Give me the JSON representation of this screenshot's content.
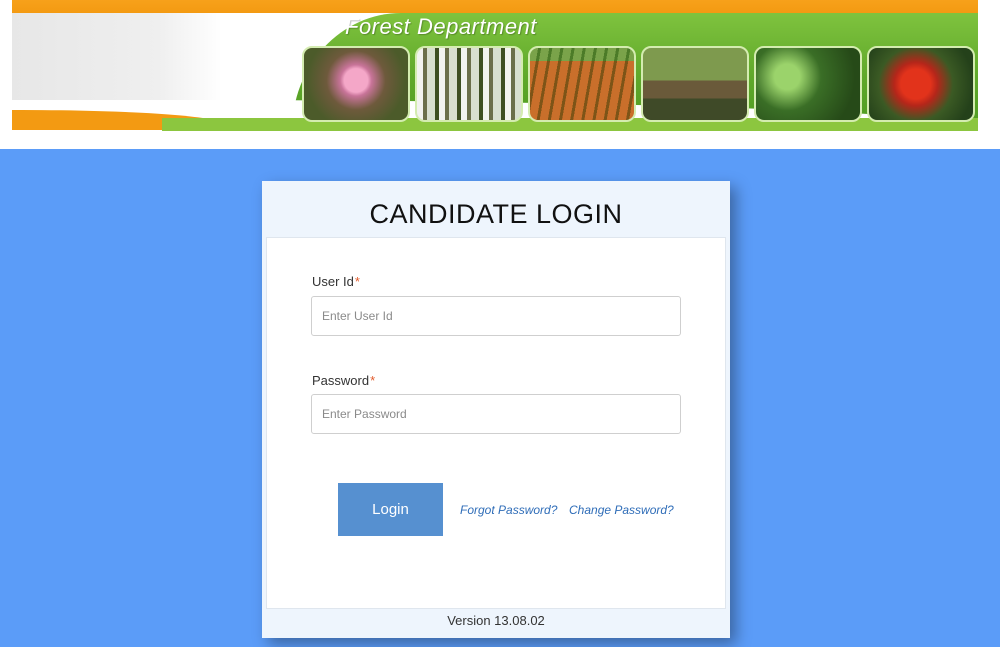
{
  "banner": {
    "title": "Forest Department",
    "photos": [
      "flower-photo",
      "forest-trees-photo",
      "plantation-field-photo",
      "nursery-photo",
      "leaves-photo",
      "red-flowers-photo"
    ]
  },
  "colors": {
    "page_background": "#5b9cf8",
    "login_button": "#5690d0",
    "link": "#2f6db8",
    "required_marker": "#e25b2c",
    "banner_orange": "#f39a12",
    "banner_green": "#5fa82a"
  },
  "login": {
    "heading": "CANDIDATE LOGIN",
    "user_id_label": "User Id",
    "user_id_placeholder": "Enter User Id",
    "user_id_value": "",
    "password_label": "Password",
    "password_placeholder": "Enter Password",
    "password_value": "",
    "required_marker": "*",
    "login_button": "Login",
    "forgot_password": "Forgot Password?",
    "change_password": "Change Password?",
    "version": "Version 13.08.02"
  }
}
